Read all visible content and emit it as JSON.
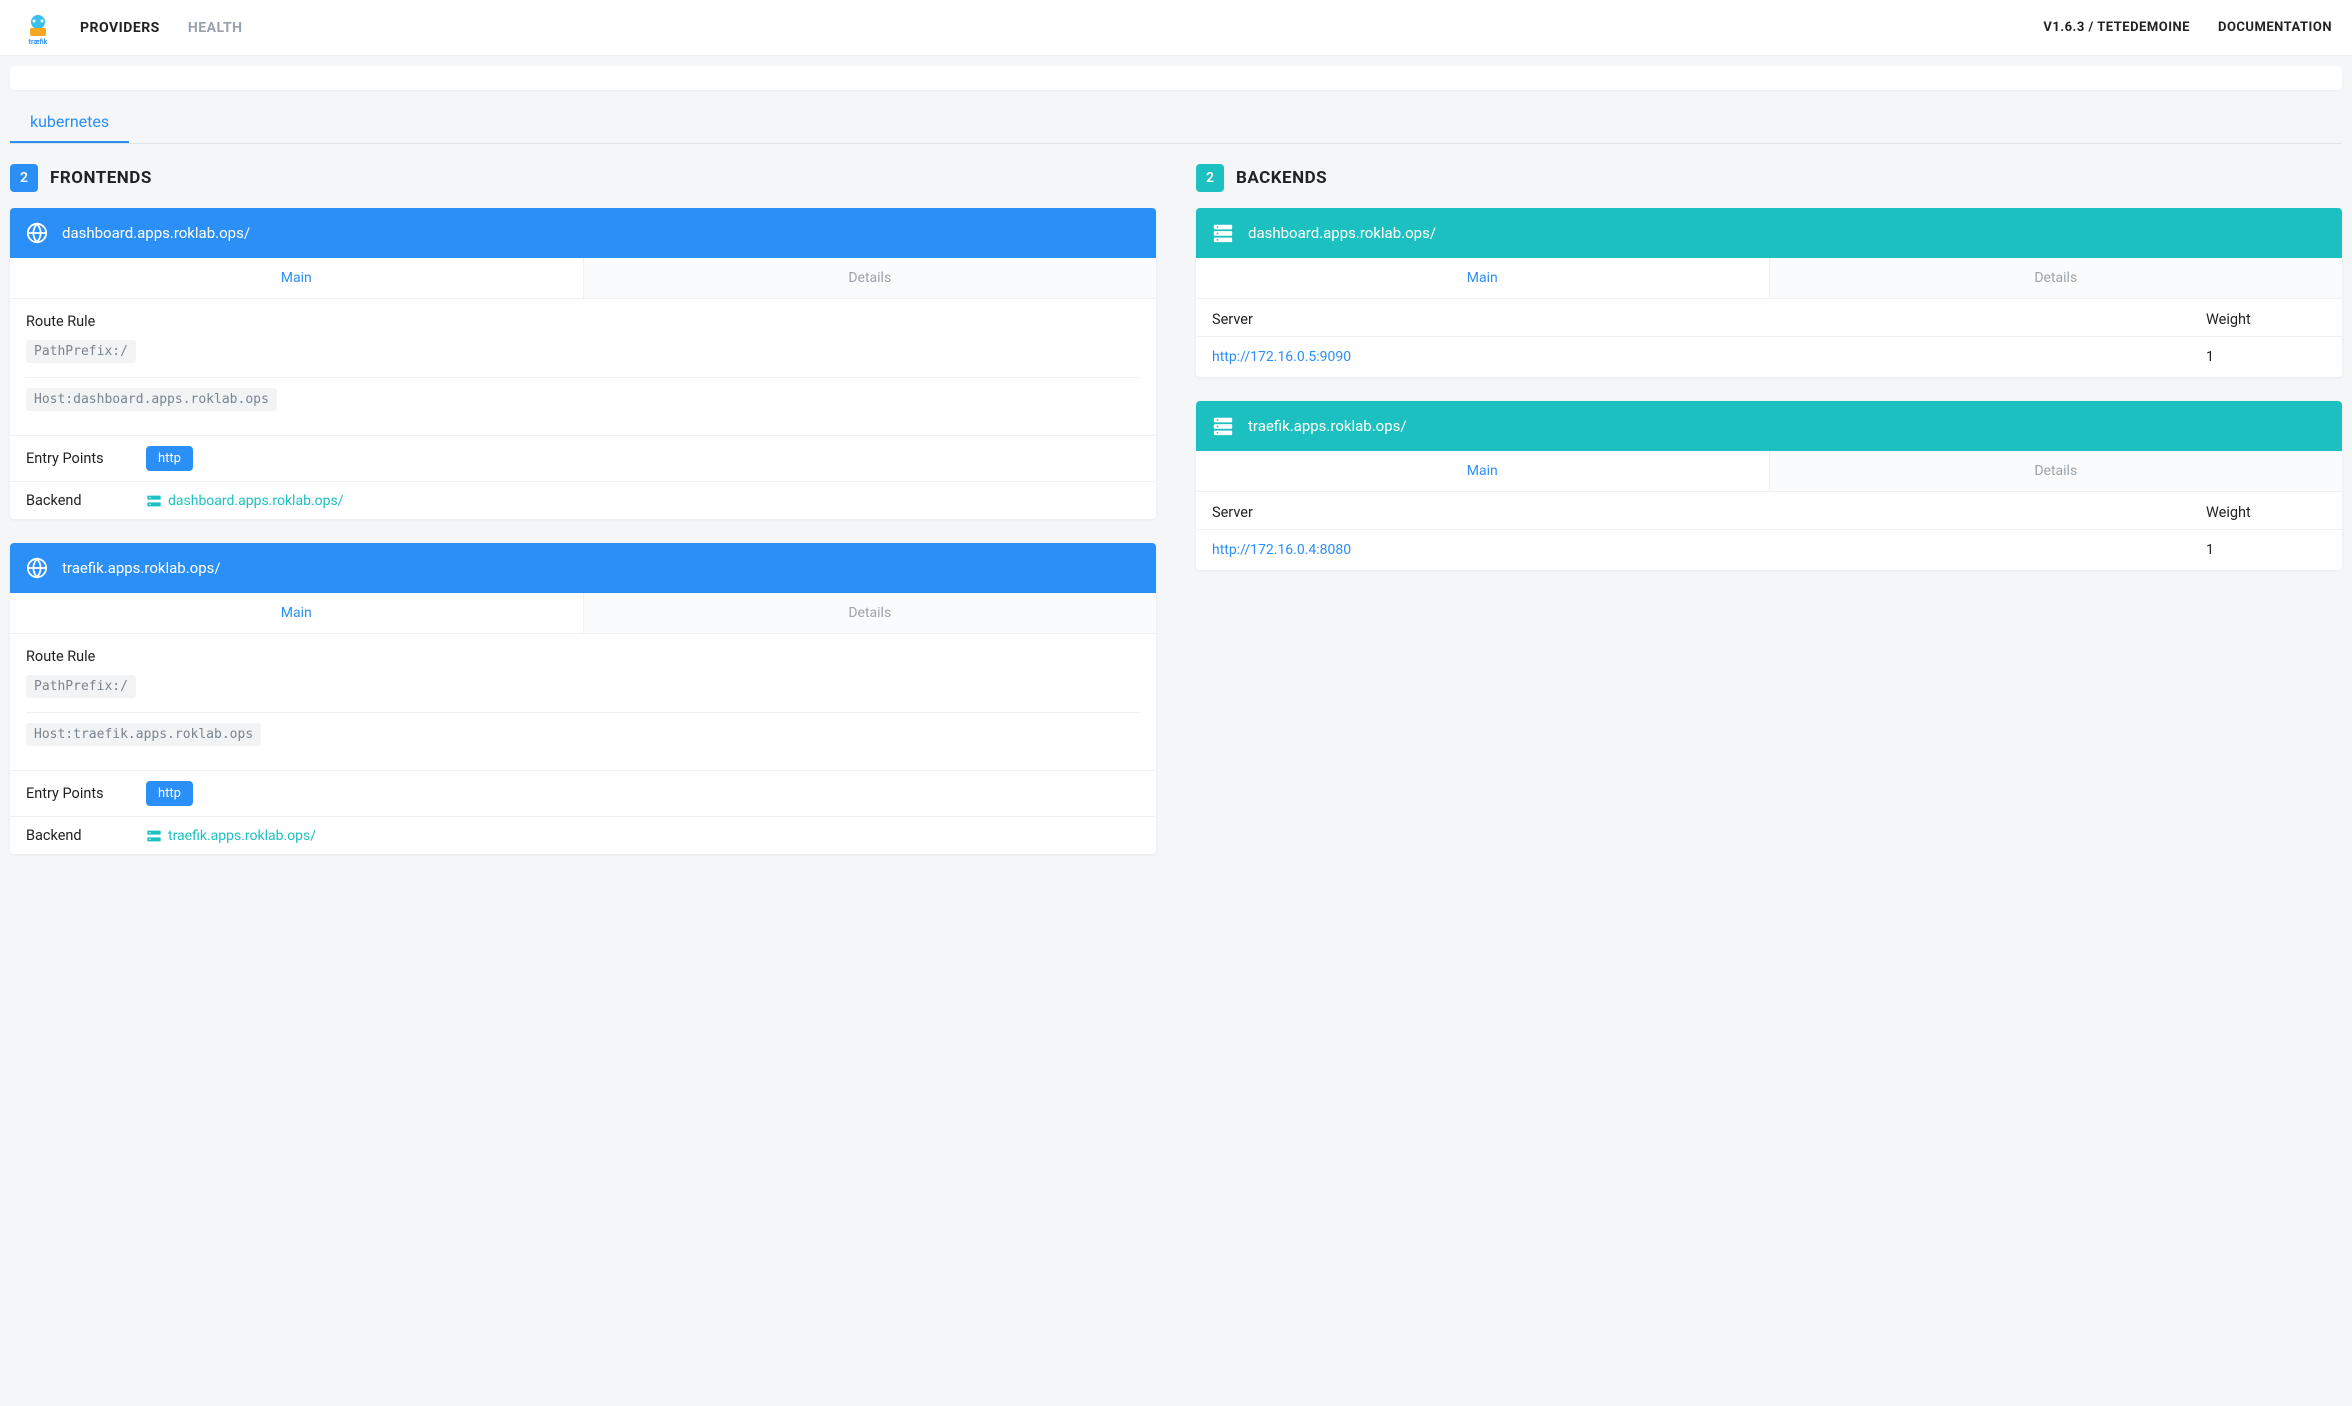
{
  "nav": {
    "links": [
      "PROVIDERS",
      "HEALTH"
    ],
    "version": "V1.6.3 / TETEDEMOINE",
    "docs": "DOCUMENTATION"
  },
  "providerTab": "kubernetes",
  "frontends": {
    "count": "2",
    "title": "FRONTENDS",
    "tabs": {
      "main": "Main",
      "details": "Details"
    },
    "labels": {
      "routeRule": "Route Rule",
      "entryPoints": "Entry Points",
      "backend": "Backend",
      "http": "http"
    },
    "items": [
      {
        "name": "dashboard.apps.roklab.ops/",
        "rules": [
          "PathPrefix:/",
          "Host:dashboard.apps.roklab.ops"
        ],
        "backend": "dashboard.apps.roklab.ops/"
      },
      {
        "name": "traefik.apps.roklab.ops/",
        "rules": [
          "PathPrefix:/",
          "Host:traefik.apps.roklab.ops"
        ],
        "backend": "traefik.apps.roklab.ops/"
      }
    ]
  },
  "backends": {
    "count": "2",
    "title": "BACKENDS",
    "tabs": {
      "main": "Main",
      "details": "Details"
    },
    "labels": {
      "server": "Server",
      "weight": "Weight"
    },
    "items": [
      {
        "name": "dashboard.apps.roklab.ops/",
        "servers": [
          {
            "url": "http://172.16.0.5:9090",
            "weight": "1"
          }
        ]
      },
      {
        "name": "traefik.apps.roklab.ops/",
        "servers": [
          {
            "url": "http://172.16.0.4:8080",
            "weight": "1"
          }
        ]
      }
    ]
  }
}
